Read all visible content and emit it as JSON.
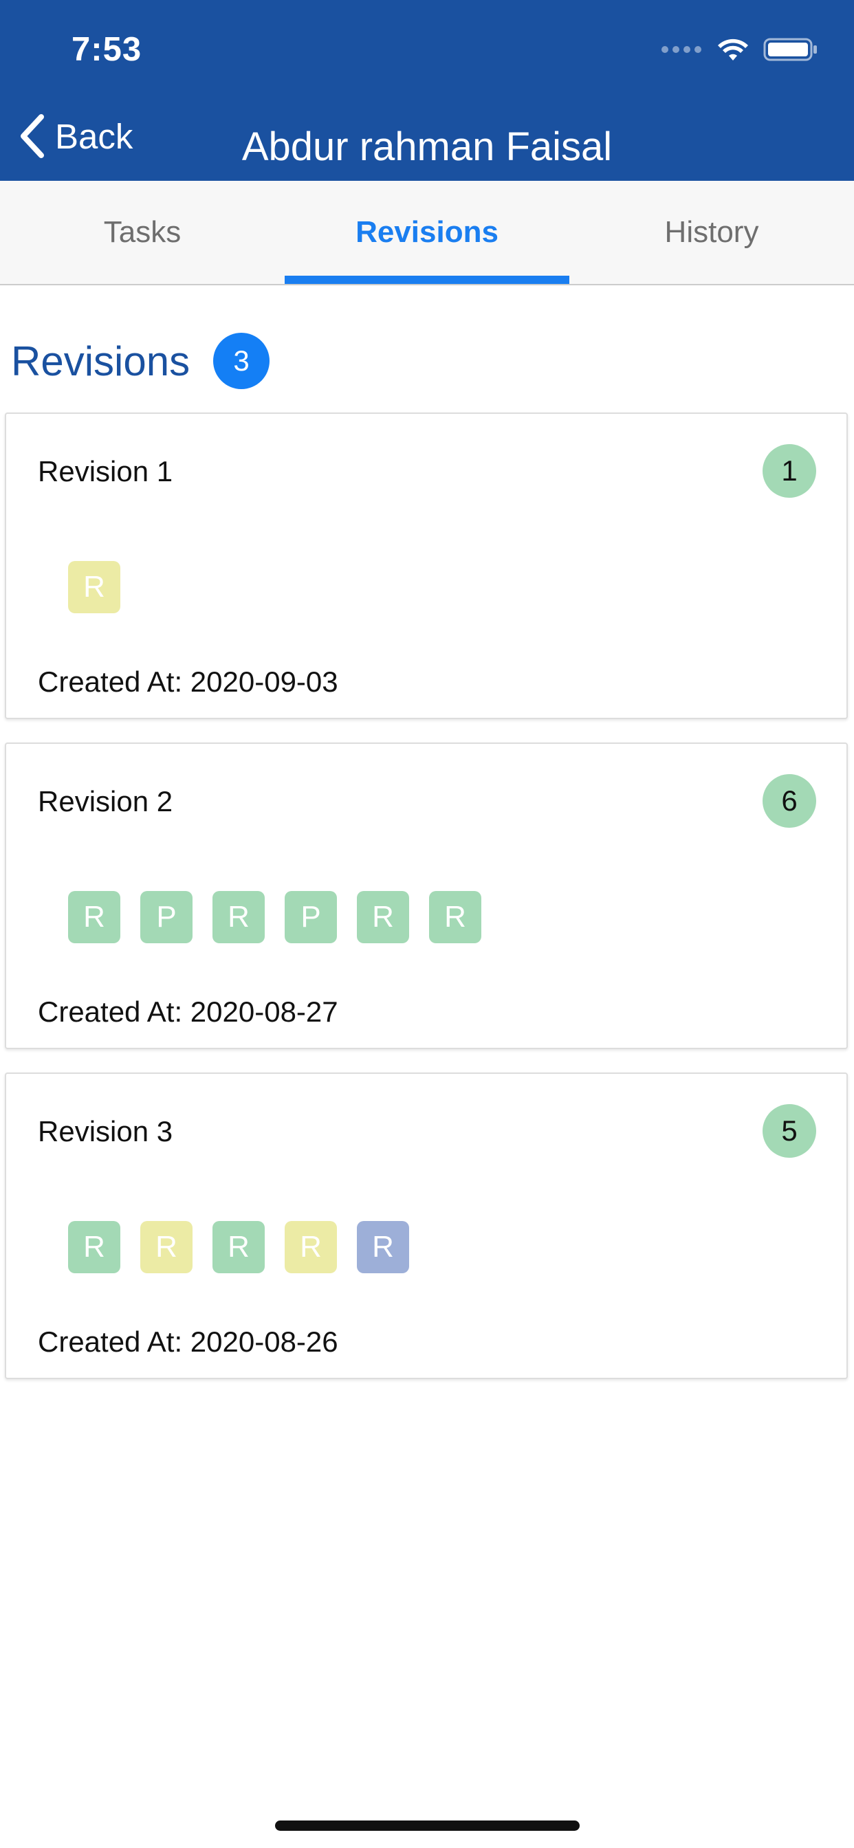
{
  "status_bar": {
    "time": "7:53"
  },
  "nav": {
    "back_label": "Back",
    "title": "Abdur rahman Faisal"
  },
  "tabs": [
    {
      "label": "Tasks",
      "active": false
    },
    {
      "label": "Revisions",
      "active": true
    },
    {
      "label": "History",
      "active": false
    }
  ],
  "section": {
    "title": "Revisions",
    "count": "3"
  },
  "colors": {
    "header_bg": "#1a51a0",
    "accent": "#1a7ef0",
    "badge_blue": "#147ff5",
    "count_green": "#a3d9b5",
    "chip_green": "#a3d9b5",
    "chip_yellow": "#eceba5",
    "chip_blue": "#9dafd8"
  },
  "revisions": [
    {
      "title": "Revision 1",
      "count": "1",
      "chips": [
        {
          "label": "R",
          "color": "yellow"
        }
      ],
      "created_at": "Created At: 2020-09-03"
    },
    {
      "title": "Revision 2",
      "count": "6",
      "chips": [
        {
          "label": "R",
          "color": "green"
        },
        {
          "label": "P",
          "color": "green"
        },
        {
          "label": "R",
          "color": "green"
        },
        {
          "label": "P",
          "color": "green"
        },
        {
          "label": "R",
          "color": "green"
        },
        {
          "label": "R",
          "color": "green"
        }
      ],
      "created_at": "Created At: 2020-08-27"
    },
    {
      "title": "Revision 3",
      "count": "5",
      "chips": [
        {
          "label": "R",
          "color": "green"
        },
        {
          "label": "R",
          "color": "yellow"
        },
        {
          "label": "R",
          "color": "green"
        },
        {
          "label": "R",
          "color": "yellow"
        },
        {
          "label": "R",
          "color": "blue"
        }
      ],
      "created_at": "Created At: 2020-08-26"
    }
  ]
}
